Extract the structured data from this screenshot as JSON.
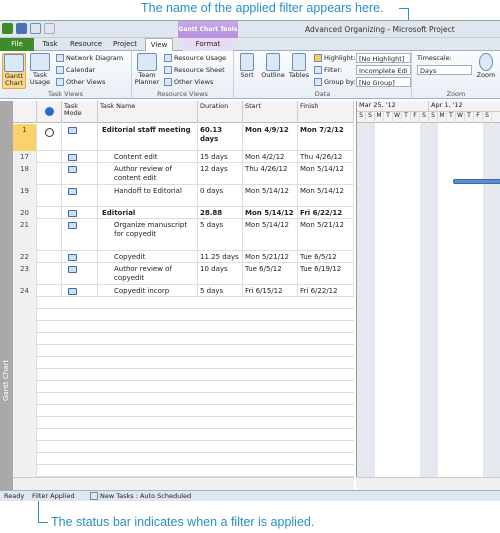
{
  "callouts": {
    "top": "The name of the applied filter appears here.",
    "bottom": "The status bar indicates when a filter is applied."
  },
  "app": {
    "title": "Advanced Organizing - Microsoft Project",
    "context_group": "Gantt Chart Tools"
  },
  "tabs": [
    "File",
    "Task",
    "Resource",
    "Project",
    "View",
    "Format"
  ],
  "ribbon": {
    "task_views": {
      "label": "Task Views",
      "gantt": "Gantt Chart",
      "task_usage": "Task Usage",
      "network": "Network Diagram",
      "calendar": "Calendar",
      "other": "Other Views"
    },
    "resource_views": {
      "label": "Resource Views",
      "team_planner": "Team Planner",
      "usage": "Resource Usage",
      "sheet": "Resource Sheet",
      "other": "Other Views"
    },
    "data": {
      "label": "Data",
      "sort": "Sort",
      "outline": "Outline",
      "tables": "Tables",
      "highlight_label": "Highlight:",
      "highlight_value": "[No Highlight]",
      "filter_label": "Filter:",
      "filter_value": "Incomplete Edi",
      "groupby_label": "Group by:",
      "groupby_value": "[No Group]"
    },
    "zoom": {
      "label": "Zoom",
      "timescale_label": "Timescale:",
      "timescale_value": "Days",
      "zoom_btn": "Zoom"
    }
  },
  "sidebar_label": "Gantt Chart",
  "columns": {
    "info": "i",
    "mode": "Task Mode",
    "name": "Task Name",
    "duration": "Duration",
    "start": "Start",
    "finish": "Finish"
  },
  "rows": [
    {
      "id": "1",
      "name": "Editorial staff meeting",
      "duration": "60.13 days",
      "start": "Mon 4/9/12",
      "finish": "Mon 7/2/12"
    },
    {
      "id": "17",
      "name": "Content edit",
      "duration": "15 days",
      "start": "Mon 4/2/12",
      "finish": "Thu 4/26/12"
    },
    {
      "id": "18",
      "name": "Author review of content edit",
      "duration": "12 days",
      "start": "Thu 4/26/12",
      "finish": "Mon 5/14/12"
    },
    {
      "id": "19",
      "name": "Handoff to Editorial",
      "duration": "0 days",
      "start": "Mon 5/14/12",
      "finish": "Mon 5/14/12"
    },
    {
      "id": "20",
      "name": "Editorial",
      "duration": "28.88 days",
      "start": "Mon 5/14/12",
      "finish": "Fri 6/22/12"
    },
    {
      "id": "21",
      "name": "Organize manuscript for copyedit",
      "duration": "5 days",
      "start": "Mon 5/14/12",
      "finish": "Mon 5/21/12"
    },
    {
      "id": "22",
      "name": "Copyedit",
      "duration": "11.25 days",
      "start": "Mon 5/21/12",
      "finish": "Tue 6/5/12"
    },
    {
      "id": "23",
      "name": "Author review of copyedit",
      "duration": "10 days",
      "start": "Tue 6/5/12",
      "finish": "Tue 6/19/12"
    },
    {
      "id": "24",
      "name": "Copyedit incorp",
      "duration": "5 days",
      "start": "Fri 6/15/12",
      "finish": "Fri 6/22/12"
    }
  ],
  "timeline": {
    "weeks": [
      "Mar 25, '12",
      "Apr 1, '12"
    ],
    "days": [
      "S",
      "S",
      "M",
      "T",
      "W",
      "T",
      "F",
      "S",
      "S",
      "M",
      "T",
      "W",
      "T",
      "F",
      "S"
    ]
  },
  "status": {
    "ready": "Ready",
    "filter": "Filter Applied",
    "new_tasks": "New Tasks : Auto Scheduled"
  }
}
